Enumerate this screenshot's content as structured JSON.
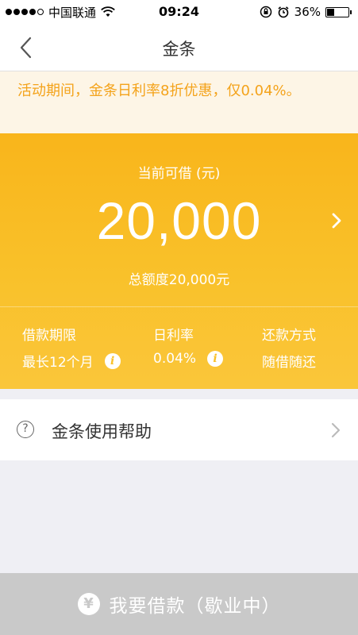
{
  "status_bar": {
    "carrier": "中国联通",
    "time": "09:24",
    "battery": "36%",
    "battery_level": 0.36,
    "signal_strength": 4,
    "signal_max": 5
  },
  "nav": {
    "title": "金条",
    "back_icon": "chevron-left-icon"
  },
  "notice": {
    "text": "活动期间，金条日利率8折优惠，仅0.04%。"
  },
  "hero": {
    "available_label": "当前可借 (元)",
    "amount": "20,000",
    "total_line": "总额度20,000元",
    "chevron_icon": "chevron-right-icon"
  },
  "info": {
    "term": {
      "title": "借款期限",
      "value": "最长12个月",
      "icon": "info-icon"
    },
    "rate": {
      "title": "日利率",
      "value": "0.04%",
      "icon": "info-icon"
    },
    "repay": {
      "title": "还款方式",
      "value": "随借随还"
    }
  },
  "help": {
    "label": "金条使用帮助",
    "icon_glyph": "?",
    "icon": "question-circle-icon"
  },
  "footer": {
    "label": "我要借款（歇业中）",
    "icon_glyph": "¥",
    "icon": "yen-icon"
  },
  "colors": {
    "accent": "#f9b51b",
    "notice_text": "#f4a31b",
    "notice_bg": "#fdf5e6",
    "footer_disabled": "#c9c9c9"
  }
}
